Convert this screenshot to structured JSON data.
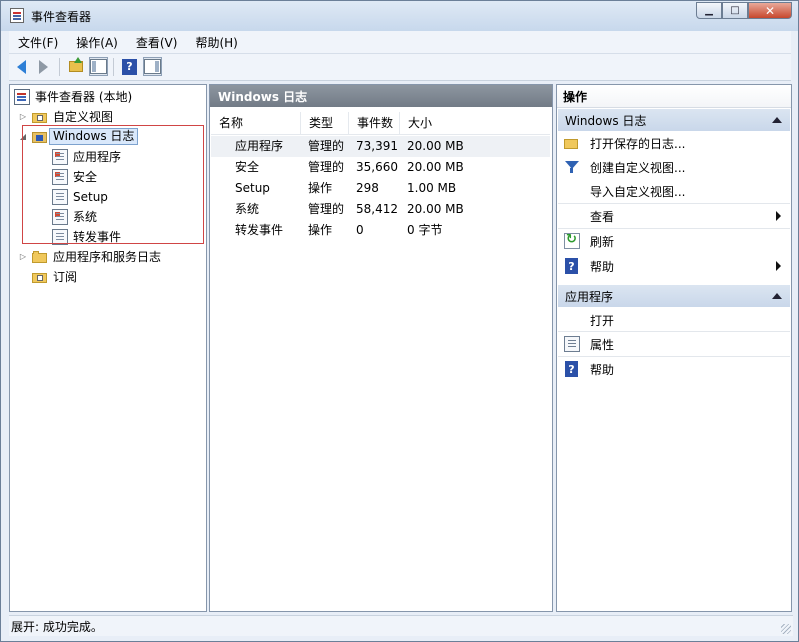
{
  "window": {
    "title": "事件查看器"
  },
  "menubar": {
    "items": [
      "文件(F)",
      "操作(A)",
      "查看(V)",
      "帮助(H)"
    ]
  },
  "tree": {
    "root": "事件查看器 (本地)",
    "custom_views": "自定义视图",
    "windows_logs": "Windows 日志",
    "children": [
      "应用程序",
      "安全",
      "Setup",
      "系统",
      "转发事件"
    ],
    "app_service_logs": "应用程序和服务日志",
    "subscriptions": "订阅"
  },
  "list": {
    "header": "Windows 日志",
    "columns": [
      "名称",
      "类型",
      "事件数",
      "大小"
    ],
    "rows": [
      {
        "name": "应用程序",
        "type": "管理的",
        "count": "73,391",
        "size": "20.00 MB"
      },
      {
        "name": "安全",
        "type": "管理的",
        "count": "35,660",
        "size": "20.00 MB"
      },
      {
        "name": "Setup",
        "type": "操作",
        "count": "298",
        "size": "1.00 MB"
      },
      {
        "name": "系统",
        "type": "管理的",
        "count": "58,412",
        "size": "20.00 MB"
      },
      {
        "name": "转发事件",
        "type": "操作",
        "count": "0",
        "size": "0 字节"
      }
    ]
  },
  "actions": {
    "header": "操作",
    "section1": "Windows 日志",
    "section1_items": [
      "打开保存的日志...",
      "创建自定义视图...",
      "导入自定义视图...",
      "查看",
      "刷新",
      "帮助"
    ],
    "section2": "应用程序",
    "section2_items": [
      "打开",
      "属性",
      "帮助"
    ]
  },
  "status": {
    "text": "展开:  成功完成。"
  },
  "colors": {
    "selection_border": "#d04545",
    "panel_header": "#7f8893",
    "section_bg": "#d1ddec"
  }
}
